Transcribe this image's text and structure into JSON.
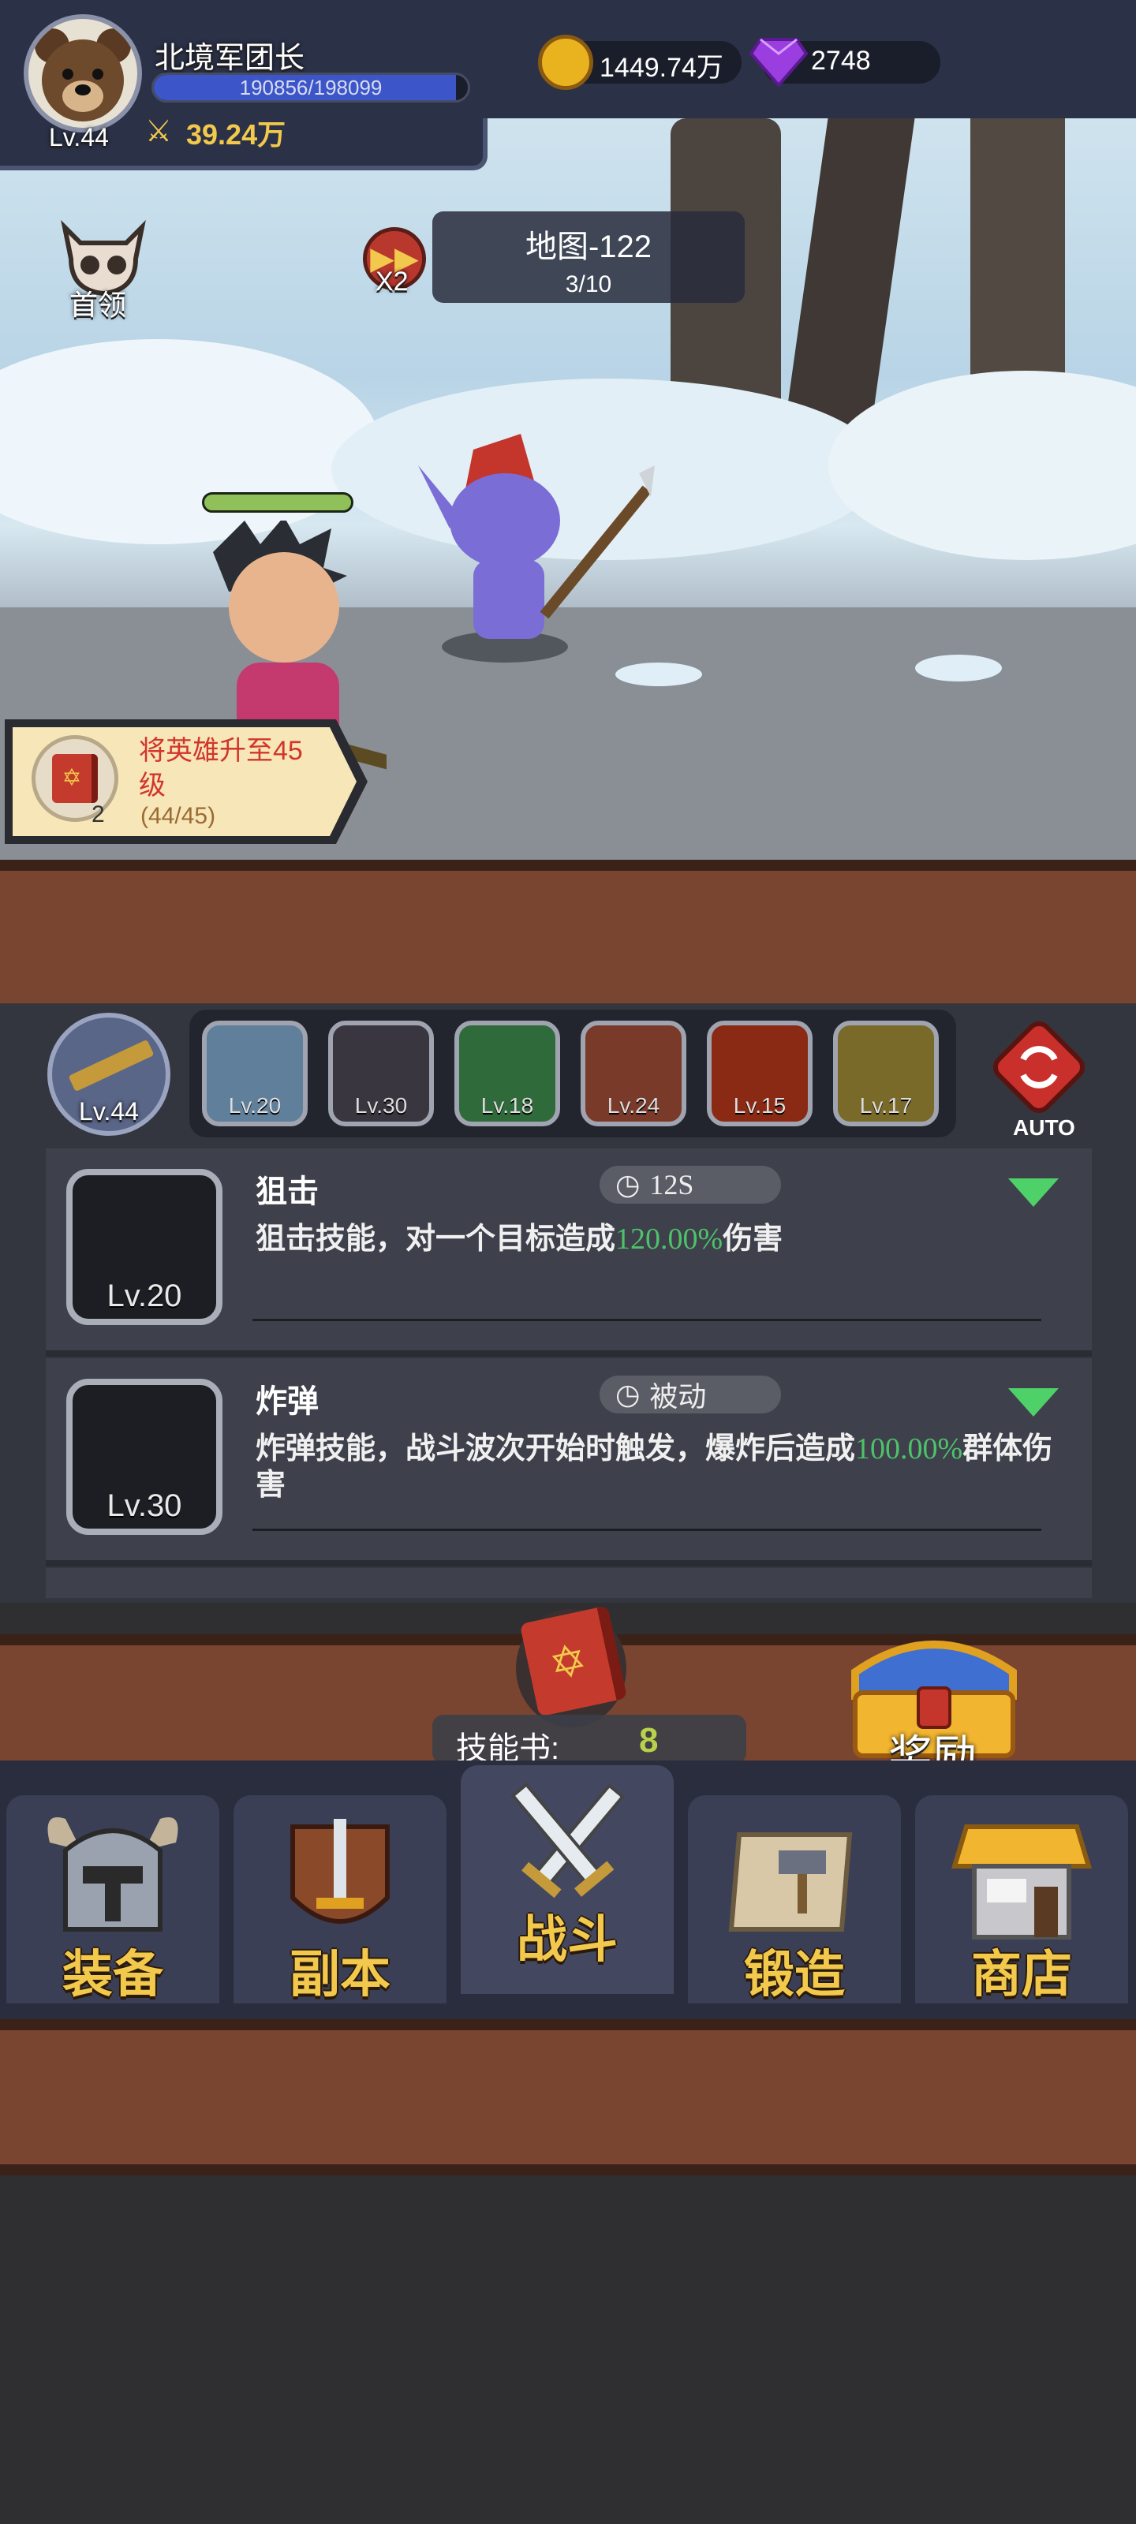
{
  "player": {
    "name": "北境军团长",
    "level": "Lv.44",
    "exp_text": "190856/198099",
    "exp_fraction": 0.963,
    "power": "39.24万"
  },
  "resources": {
    "gold": "1449.74万",
    "gems": "2748"
  },
  "battle": {
    "boss_label": "首领",
    "speed_label": "X2",
    "map_name": "地图-122",
    "wave": "3/10",
    "hero_hp_fraction": 1.0
  },
  "quest": {
    "title": "将英雄升至45级",
    "progress": "(44/45)",
    "count": "2"
  },
  "skills": {
    "weapon_level": "Lv.44",
    "slots": [
      {
        "level": "Lv.20",
        "icon": "sniper-skill-icon"
      },
      {
        "level": "Lv.30",
        "icon": "bomb-skill-icon"
      },
      {
        "level": "Lv.18",
        "icon": "poison-skill-icon"
      },
      {
        "level": "Lv.24",
        "icon": "monster-skill-icon"
      },
      {
        "level": "Lv.15",
        "icon": "fireball-skill-icon"
      },
      {
        "level": "Lv.17",
        "icon": "lightning-skill-icon"
      }
    ],
    "auto_label": "AUTO",
    "cards": [
      {
        "name": "狙击",
        "level": "Lv.20",
        "timer": "12S",
        "desc_prefix": "狙击技能，对一个目标造成",
        "desc_value": "120.00%",
        "desc_suffix": "伤害"
      },
      {
        "name": "炸弹",
        "level": "Lv.30",
        "timer": "被动",
        "desc_prefix": "炸弹技能，战斗波次开始时触发，爆炸后造成",
        "desc_value": "100.00%",
        "desc_suffix": "群体伤害"
      }
    ],
    "book_label": "技能书:",
    "book_count": "8",
    "reward_label": "奖励"
  },
  "nav": {
    "items": [
      {
        "label": "装备",
        "icon": "equipment-helmet-icon"
      },
      {
        "label": "副本",
        "icon": "dungeon-sword-icon"
      },
      {
        "label": "战斗",
        "icon": "battle-swords-icon"
      },
      {
        "label": "锻造",
        "icon": "forge-scroll-icon"
      },
      {
        "label": "商店",
        "icon": "shop-icon"
      }
    ]
  },
  "colors": {
    "gold": "#f2c94c",
    "highlight_green": "#4ec26a",
    "panel_dark": "#2b3147",
    "wood": "#7a4530"
  }
}
